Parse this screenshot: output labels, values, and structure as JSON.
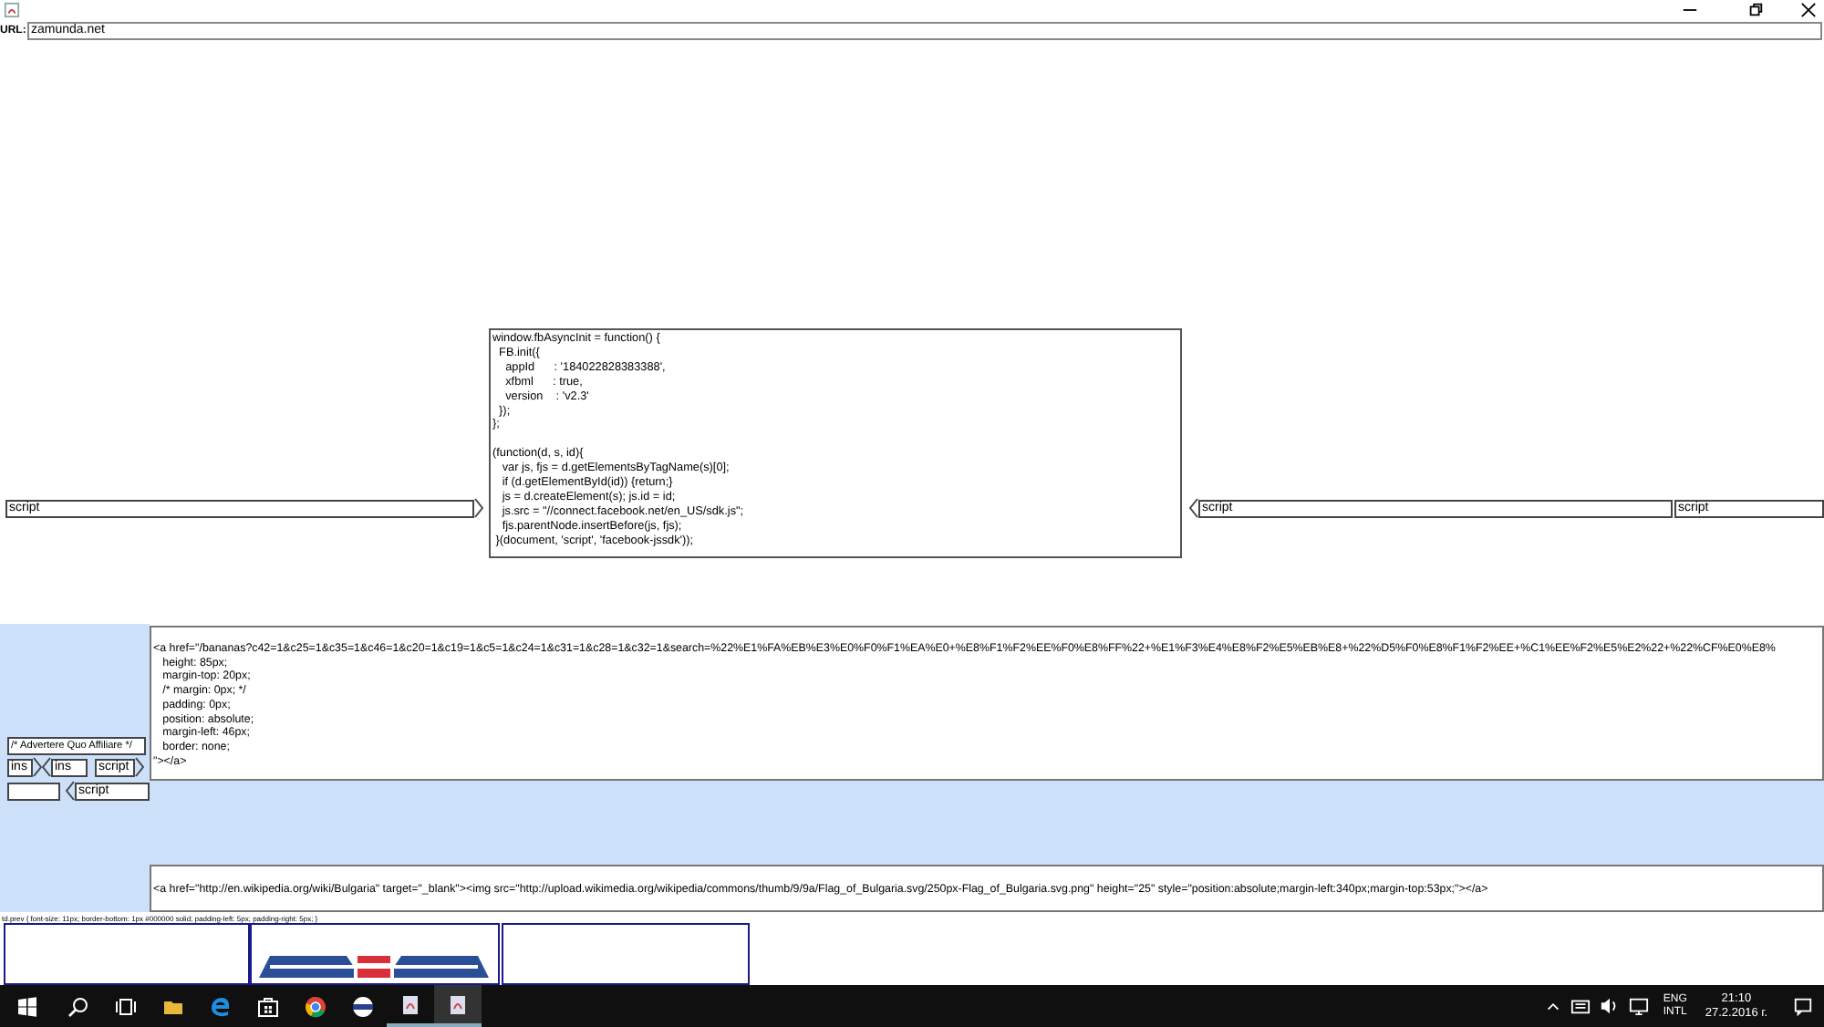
{
  "url_bar": {
    "label": "URL:",
    "value": "zamunda.net"
  },
  "code_box": {
    "blocks": [
      [
        "window.fbAsyncInit = function() {",
        "  FB.init({",
        "    appId      : '184022828383388',",
        "    xfbml      : true,",
        "    version    : 'v2.3'",
        "  });",
        "};"
      ],
      [
        "(function(d, s, id){",
        "   var js, fjs = d.getElementsByTagName(s)[0];",
        "   if (d.getElementById(id)) {return;}",
        "   js = d.createElement(s); js.id = id;",
        "   js.src = \"//connect.facebook.net/en_US/sdk.js\";",
        "   fjs.parentNode.insertBefore(js, fjs);",
        " }(document, 'script', 'facebook-jssdk'));"
      ]
    ]
  },
  "script_row": [
    {
      "label": "script",
      "kind": "open"
    },
    {
      "label": "script",
      "kind": "close"
    },
    {
      "label": "script",
      "kind": "plain"
    }
  ],
  "ad_nodes": {
    "comment": "/* Advertere Quo Affiliare */",
    "row": [
      {
        "label": "ins",
        "kind": "open"
      },
      {
        "label": "ins",
        "kind": "close"
      },
      {
        "label": "script",
        "kind": "open"
      }
    ],
    "bottom": [
      {
        "kind": "plain"
      },
      {
        "label": "script",
        "kind": "close"
      }
    ]
  },
  "link_box": {
    "lines": [
      "<a href=\"/bananas?c42=1&c25=1&c35=1&c46=1&c20=1&c19=1&c5=1&c24=1&c31=1&c28=1&c32=1&search=%22%E1%FA%EB%E3%E0%F0%F1%EA%E0+%E8%F1%F2%EE%F0%E8%FF%22+%E1%F3%E4%E8%F2%E5%EB%E8+%22%D5%F0%E8%F1%F2%EE+%C1%EE%F2%E5%E2%22+%22%CF%E0%E8%",
      "   height: 85px;",
      "   margin-top: 20px;",
      "   /* margin: 0px; */",
      "   padding: 0px;",
      "   position: absolute;",
      "   margin-left: 46px;",
      "   border: none;",
      "\"></a>"
    ]
  },
  "flag_link": "<a href=\"http://en.wikipedia.org/wiki/Bulgaria\" target=\"_blank\"><img src=\"http://upload.wikimedia.org/wikipedia/commons/thumb/9/9a/Flag_of_Bulgaria.svg/250px-Flag_of_Bulgaria.svg.png\" height=\"25\" style=\"position:absolute;margin-left:340px;margin-top:53px;\"></a>",
  "css_rule": "td.prev { font-size: 11px; border-bottom: 1px #000000 solid; padding-left: 5px; padding-right: 5px; }",
  "taskbar": {
    "language": [
      "ENG",
      "INTL"
    ],
    "time": "21:10",
    "date": "27.2.2016 г."
  }
}
